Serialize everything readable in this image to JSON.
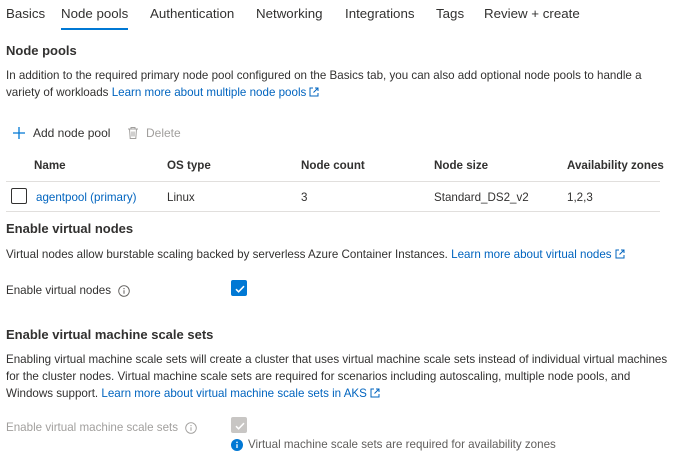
{
  "tabs": [
    {
      "label": "Basics",
      "active": false
    },
    {
      "label": "Node pools",
      "active": true
    },
    {
      "label": "Authentication",
      "active": false
    },
    {
      "label": "Networking",
      "active": false
    },
    {
      "label": "Integrations",
      "active": false
    },
    {
      "label": "Tags",
      "active": false
    },
    {
      "label": "Review + create",
      "active": false
    }
  ],
  "node_pools": {
    "heading": "Node pools",
    "description": "In addition to the required primary node pool configured on the Basics tab, you can also add optional node pools to handle a variety of workloads",
    "learn_more": "Learn more about multiple node pools",
    "toolbar": {
      "add_label": "Add node pool",
      "delete_label": "Delete"
    },
    "table": {
      "columns": [
        "Name",
        "OS type",
        "Node count",
        "Node size",
        "Availability zones"
      ],
      "rows": [
        {
          "name": "agentpool (primary)",
          "os_type": "Linux",
          "node_count": "3",
          "node_size": "Standard_DS2_v2",
          "zones": "1,2,3",
          "selected": false
        }
      ]
    }
  },
  "virtual_nodes": {
    "heading": "Enable virtual nodes",
    "description": "Virtual nodes allow burstable scaling backed by serverless Azure Container Instances.",
    "learn_more": "Learn more about virtual nodes",
    "field_label": "Enable virtual nodes",
    "checked": true
  },
  "vmss": {
    "heading": "Enable virtual machine scale sets",
    "description": "Enabling virtual machine scale sets will create a cluster that uses virtual machine scale sets instead of individual virtual machines for the cluster nodes. Virtual machine scale sets are required for scenarios including autoscaling, multiple node pools, and Windows support.",
    "learn_more": "Learn more about virtual machine scale sets in AKS",
    "field_label": "Enable virtual machine scale sets",
    "checked": true,
    "disabled": true,
    "info_note": "Virtual machine scale sets are required for availability zones"
  },
  "colors": {
    "accent": "#0078d4",
    "link": "#0064bf",
    "text": "#323130",
    "disabled": "#c8c6c4"
  },
  "icons": [
    "plus-icon",
    "trash-icon",
    "external-link-icon",
    "info-icon"
  ]
}
